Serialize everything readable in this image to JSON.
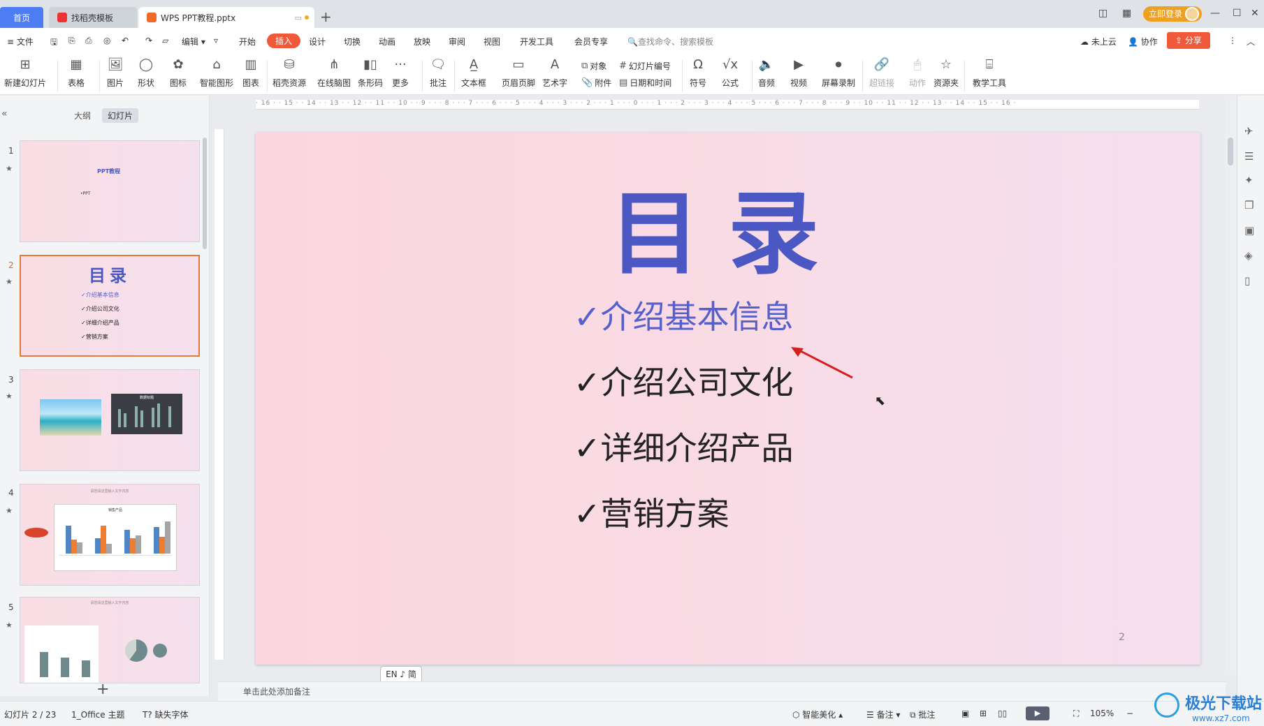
{
  "tabs": {
    "home": "首页",
    "template_tab": "找稻壳模板",
    "doc_tab": "WPS PPT教程.pptx",
    "new_tab": "+"
  },
  "titlebar": {
    "login": "立即登录"
  },
  "menu": {
    "file": "文件",
    "edit": "编辑",
    "items": [
      "开始",
      "插入",
      "设计",
      "切换",
      "动画",
      "放映",
      "审阅",
      "视图",
      "开发工具",
      "会员专享"
    ],
    "active": "插入",
    "search_placeholder": "查找命令、搜索模板",
    "cloud": "未上云",
    "collab": "协作",
    "share": "分享"
  },
  "ribbon": {
    "new_slide": "新建幻灯片",
    "table": "表格",
    "picture": "图片",
    "shape": "形状",
    "icon": "图标",
    "smart_graphic": "智能图形",
    "chart": "图表",
    "docer_resource": "稻壳资源",
    "mindmap": "在线脑图",
    "barcode": "条形码",
    "more": "更多",
    "comment": "批注",
    "textbox": "文本框",
    "header_footer": "页眉页脚",
    "wordart": "艺术字",
    "object": "对象",
    "attachment": "附件",
    "slide_number": "幻灯片编号",
    "datetime": "日期和时间",
    "symbol": "符号",
    "formula": "公式",
    "audio": "音频",
    "video": "视频",
    "screen_record": "屏幕录制",
    "hyperlink": "超链接",
    "action": "动作",
    "resource_folder": "资源夹",
    "teaching_tools": "教学工具"
  },
  "left_panel": {
    "outline_tab": "大纲",
    "slides_tab": "幻灯片",
    "slides": [
      {
        "num": "1",
        "title": "PPT教程",
        "sub": "•PPT"
      },
      {
        "num": "2",
        "title": "目录",
        "items": [
          "✓介绍基本信息",
          "✓介绍公司文化",
          "✓详细介绍产品",
          "✓营销方案"
        ]
      },
      {
        "num": "3",
        "chart_title": "数据标题"
      },
      {
        "num": "4",
        "caption": "请您请这里输入文字内容",
        "chart_title": "销售产品"
      },
      {
        "num": "5",
        "caption": "请您请这里输入文字内容"
      }
    ],
    "add": "+"
  },
  "slide": {
    "title": "目录",
    "bullets": [
      "✓介绍基本信息",
      "✓介绍公司文化",
      "✓详细介绍产品",
      "✓营销方案"
    ],
    "page_number": "2"
  },
  "ime": "EN ♪ 简",
  "notes_placeholder": "单击此处添加备注",
  "status": {
    "slide_info": "幻灯片 2 / 23",
    "theme": "1_Office 主题",
    "missing_font": "缺失字体",
    "smart_beautify": "智能美化",
    "notes": "备注",
    "comments": "批注",
    "zoom": "105%"
  },
  "watermark": {
    "name": "极光下载站",
    "url": "www.xz7.com"
  },
  "colors": {
    "accent": "#f05a3a",
    "title_blue": "#4b58c4",
    "home_tab": "#4d7df5"
  }
}
